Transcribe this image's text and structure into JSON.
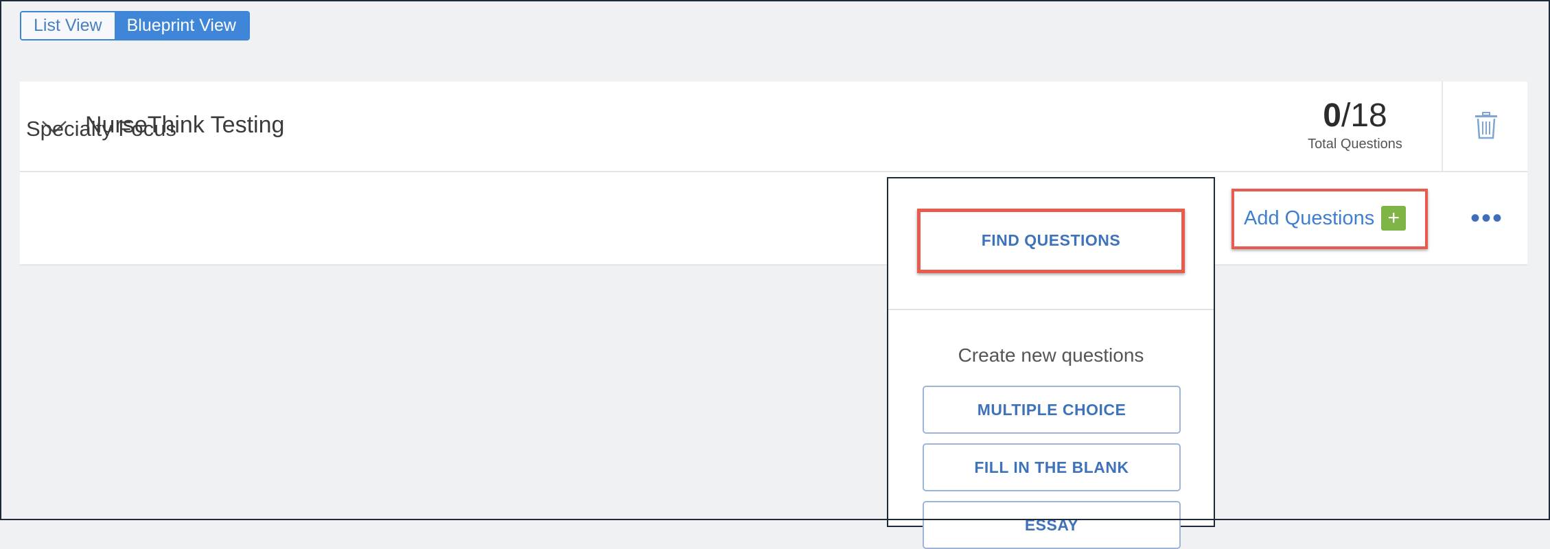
{
  "view_toggle": {
    "tabs": [
      {
        "label": "List View",
        "active": false
      },
      {
        "label": "Blueprint View",
        "active": true
      }
    ]
  },
  "section": {
    "title": "NurseThink Testing",
    "count_current": "0",
    "count_total": "/18",
    "count_label": "Total Questions"
  },
  "subsection": {
    "title": "Specialty Focus",
    "add_questions_label": "Add Questions",
    "add_plus": "+",
    "more": "•••"
  },
  "dropdown": {
    "find_label": "FIND QUESTIONS",
    "create_label": "Create new questions",
    "types": [
      "MULTIPLE CHOICE",
      "FILL IN THE BLANK",
      "ESSAY"
    ]
  },
  "colors": {
    "accent": "#3f86d9",
    "highlight": "#e85c50",
    "plus_green": "#7fb547"
  }
}
